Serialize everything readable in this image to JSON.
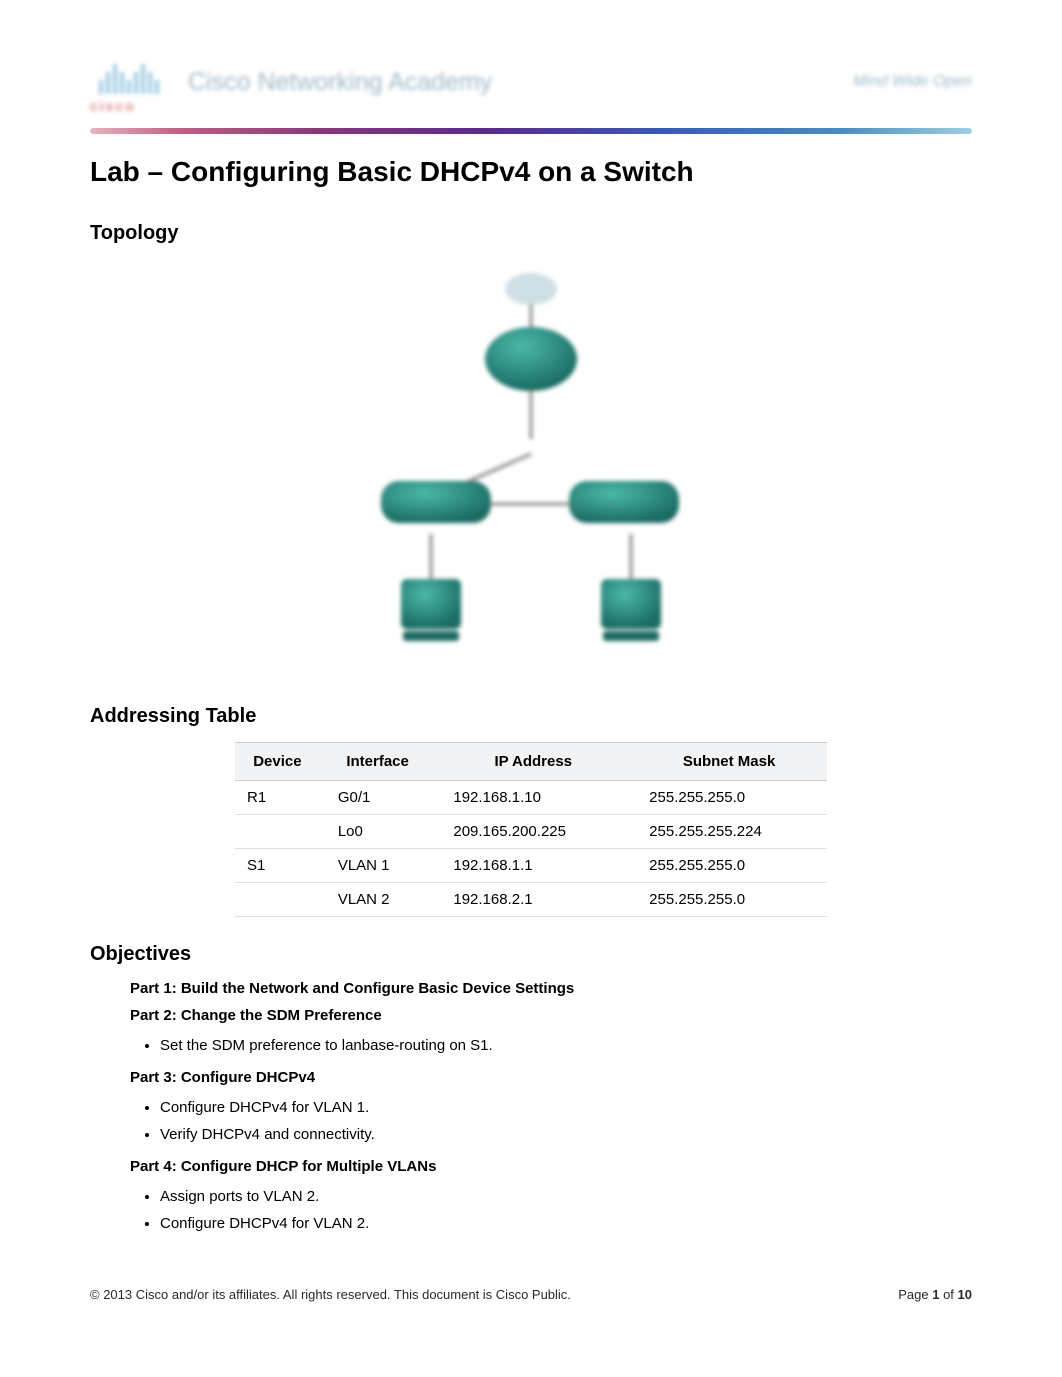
{
  "header": {
    "logo_text": "cisco",
    "academy_text": "Cisco Networking Academy",
    "right_text": "Mind Wide Open"
  },
  "title": "Lab – Configuring Basic DHCPv4 on a Switch",
  "sections": {
    "topology": {
      "heading": "Topology"
    },
    "addressing": {
      "heading": "Addressing Table",
      "columns": {
        "device": "Device",
        "interface": "Interface",
        "ip": "IP Address",
        "mask": "Subnet Mask"
      },
      "rows": [
        {
          "device": "R1",
          "interface": "G0/1",
          "ip": "192.168.1.10",
          "mask": "255.255.255.0"
        },
        {
          "device": "",
          "interface": "Lo0",
          "ip": "209.165.200.225",
          "mask": "255.255.255.224"
        },
        {
          "device": "S1",
          "interface": "VLAN 1",
          "ip": "192.168.1.1",
          "mask": "255.255.255.0"
        },
        {
          "device": "",
          "interface": "VLAN 2",
          "ip": "192.168.2.1",
          "mask": "255.255.255.0"
        }
      ]
    },
    "objectives": {
      "heading": "Objectives",
      "parts": {
        "p1": {
          "title": "Part 1: Build the Network and Configure Basic Device Settings"
        },
        "p2": {
          "title": "Part 2: Change the SDM Preference",
          "bullets": [
            "Set the SDM preference to lanbase-routing on S1."
          ]
        },
        "p3": {
          "title": "Part 3: Configure DHCPv4",
          "bullets": [
            "Configure DHCPv4 for VLAN 1.",
            "Verify DHCPv4 and connectivity."
          ]
        },
        "p4": {
          "title": "Part 4: Configure DHCP for Multiple VLANs",
          "bullets": [
            "Assign ports to VLAN 2.",
            "Configure DHCPv4 for VLAN 2."
          ]
        }
      }
    }
  },
  "footer": {
    "copyright": "© 2013 Cisco and/or its affiliates. All rights reserved. This document is Cisco Public.",
    "page_label_pre": "Page ",
    "page_current": "1",
    "page_of": " of ",
    "page_total": "10"
  }
}
